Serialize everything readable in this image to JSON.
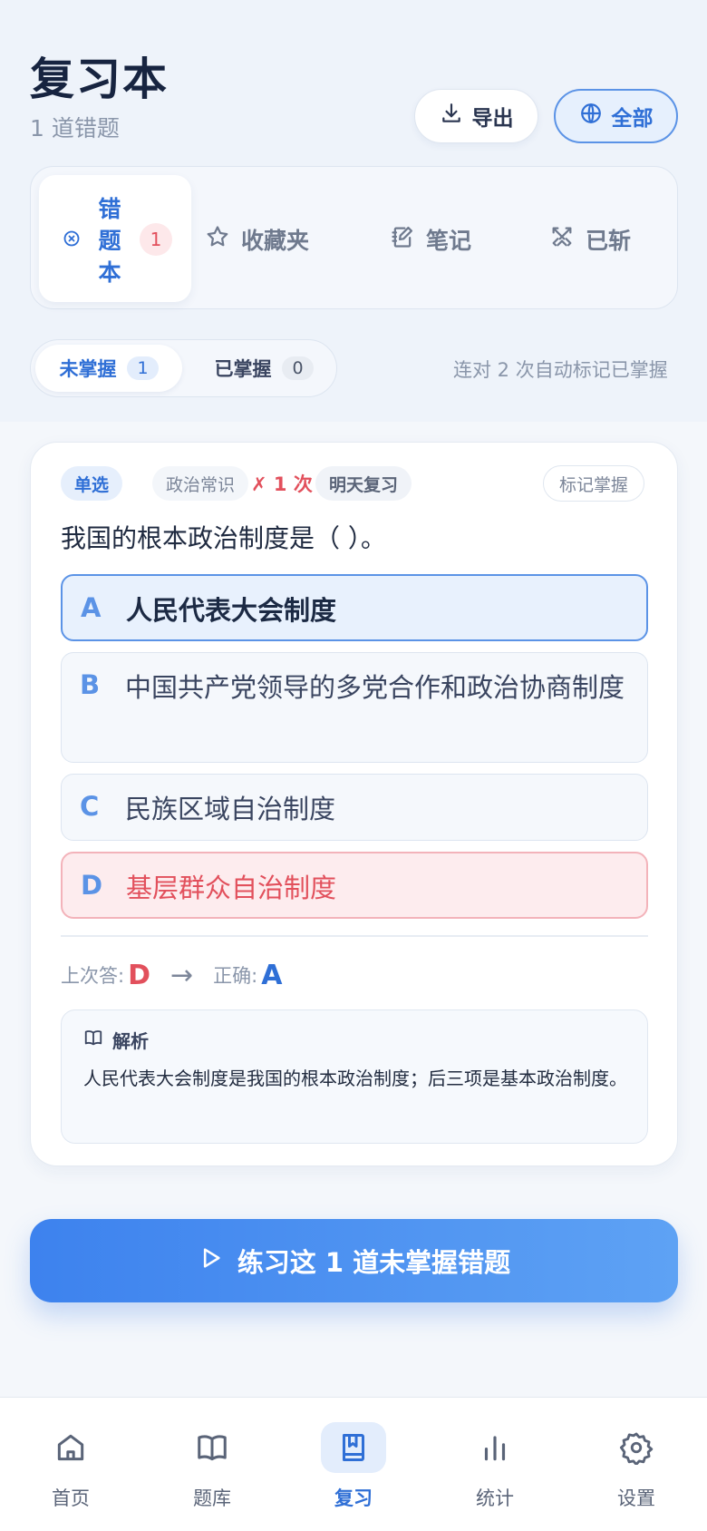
{
  "header": {
    "title": "复习本",
    "subtitle": "1 道错题",
    "export_label": "导出",
    "scope_label": "全部"
  },
  "tabs": [
    {
      "label": "错题本",
      "chars": [
        "错",
        "题",
        "本"
      ],
      "count": "1",
      "icon": "x-circle-icon",
      "active": true
    },
    {
      "label": "收藏夹",
      "icon": "star-icon",
      "active": false
    },
    {
      "label": "笔记",
      "icon": "note-edit-icon",
      "active": false
    },
    {
      "label": "已斩",
      "icon": "crossed-swords-icon",
      "active": false
    }
  ],
  "filter": {
    "unmastered_label": "未掌握",
    "unmastered_count": "1",
    "mastered_label": "已掌握",
    "mastered_count": "0",
    "hint": "连对 2 次自动标记已掌握"
  },
  "question": {
    "type_tag": "单选",
    "subject_tag": "政治常识",
    "wrong_count": "✗ 1 次",
    "review_tag": "明天复习",
    "mark_button": "标记掌握",
    "stem": "我国的根本政治制度是（ ）。",
    "options": [
      {
        "letter": "A",
        "text": "人民代表大会制度",
        "state": "correct"
      },
      {
        "letter": "B",
        "text": "中国共产党领导的多党合作和政治协商制度",
        "state": "normal"
      },
      {
        "letter": "C",
        "text": "民族区域自治制度",
        "state": "normal"
      },
      {
        "letter": "D",
        "text": "基层群众自治制度",
        "state": "wrong"
      }
    ],
    "last_answer_label": "上次答:",
    "last_answer": "D",
    "arrow": "→",
    "correct_label": "正确:",
    "correct_answer": "A",
    "explanation_icon": "book-icon",
    "explanation_title": "解析",
    "explanation_text": "人民代表大会制度是我国的根本政治制度；后三项是基本政治制度。"
  },
  "practice_button": "练习这 1 道未掌握错题",
  "nav": [
    {
      "label": "首页",
      "icon": "home-icon",
      "active": false
    },
    {
      "label": "题库",
      "icon": "open-book-icon",
      "active": false
    },
    {
      "label": "复习",
      "icon": "bookmark-book-icon",
      "active": true
    },
    {
      "label": "统计",
      "icon": "bar-chart-icon",
      "active": false
    },
    {
      "label": "设置",
      "icon": "gear-icon",
      "active": false
    }
  ],
  "colors": {
    "accent": "#2f6fd6",
    "error": "#e2505c",
    "text_primary": "#1c2a44",
    "text_muted": "#8a96aa"
  }
}
